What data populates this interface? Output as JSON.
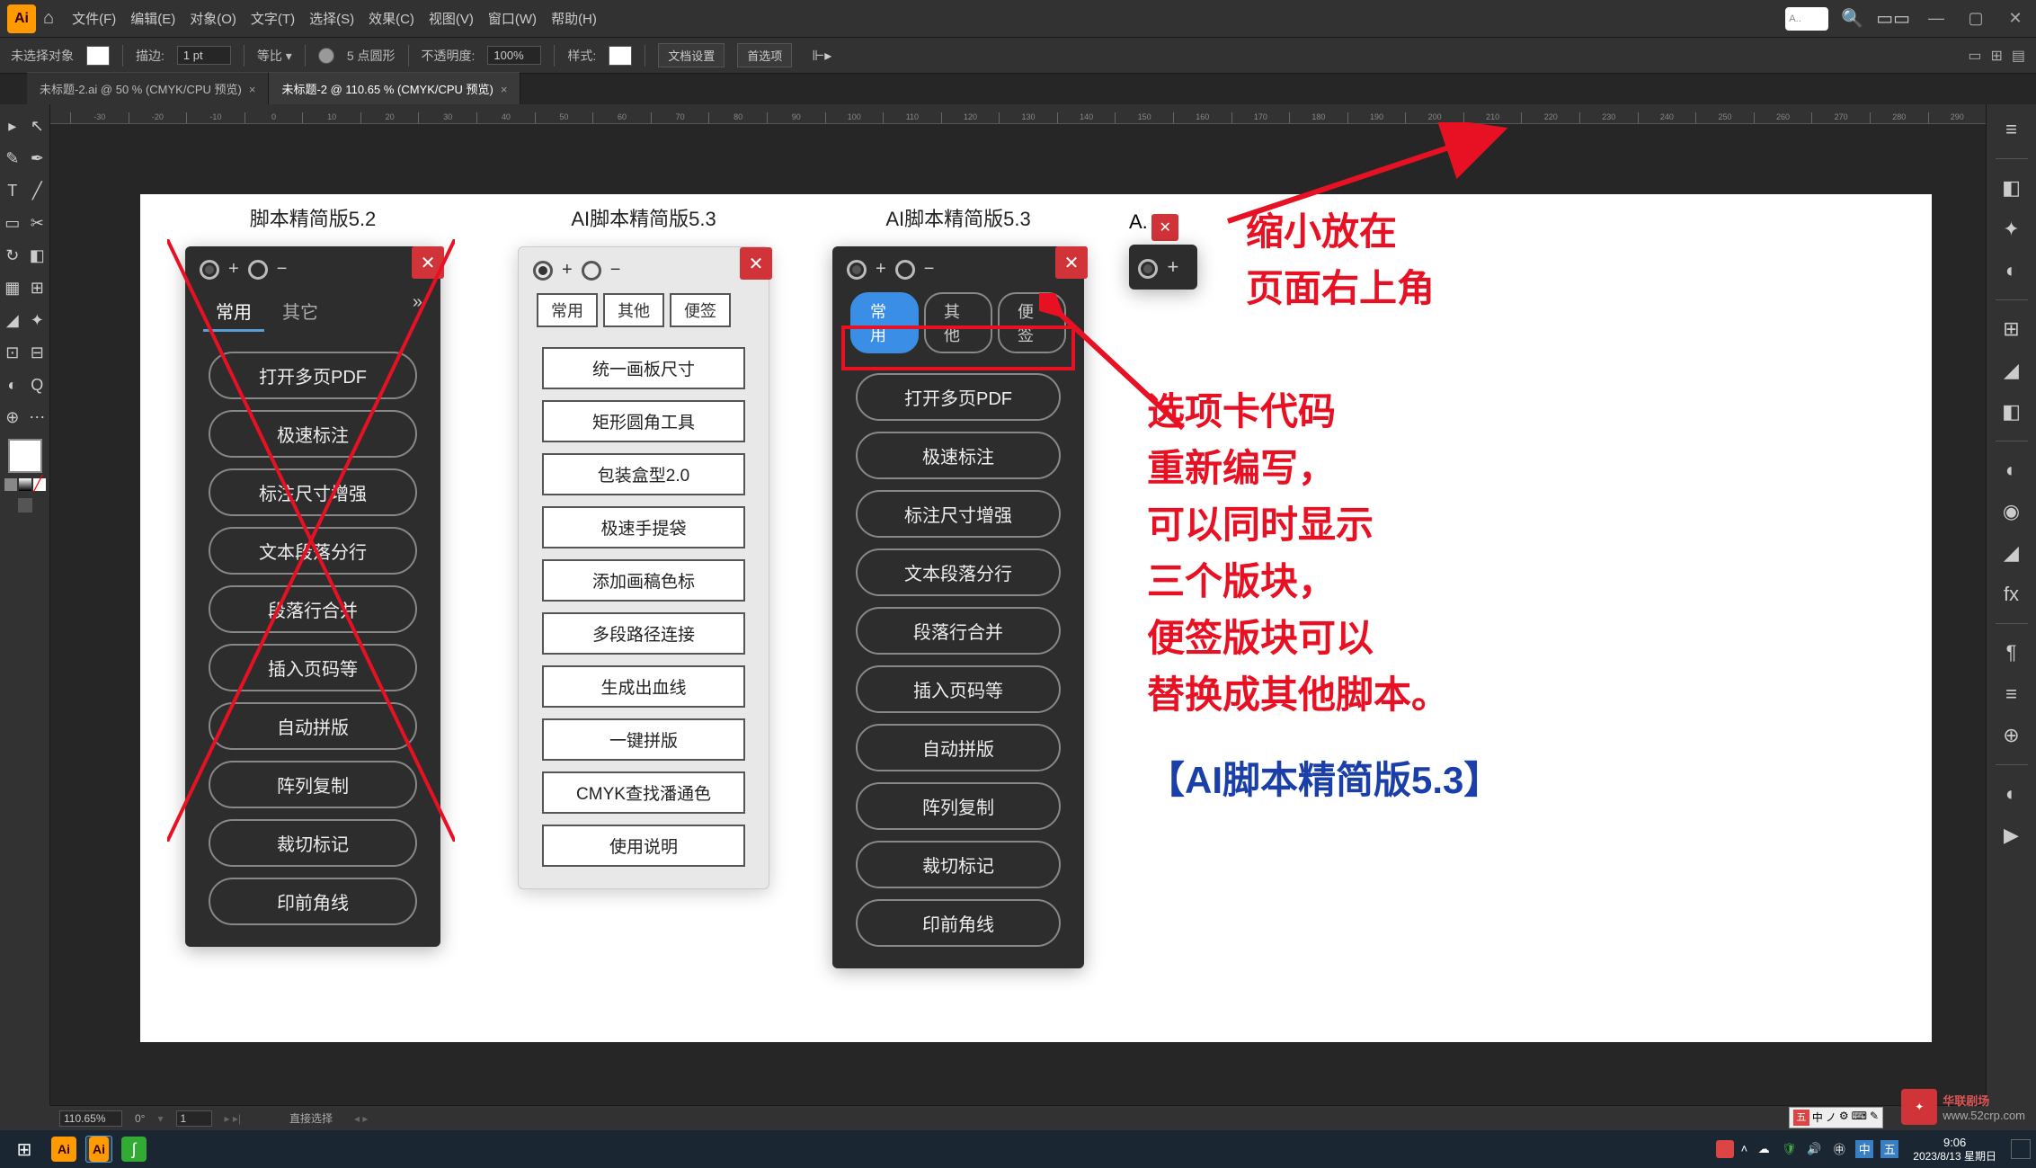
{
  "app": {
    "logo": "Ai",
    "home": "⌂"
  },
  "menu": [
    "文件(F)",
    "编辑(E)",
    "对象(O)",
    "文字(T)",
    "选择(S)",
    "效果(C)",
    "视图(V)",
    "窗口(W)",
    "帮助(H)"
  ],
  "top_right": {
    "search_placeholder": "A..",
    "search_icon": "🔍",
    "layout_icon": "▭▭"
  },
  "optbar": {
    "no_selection": "未选择对象",
    "stroke_label": "描边:",
    "stroke_val": "1 pt",
    "uniform": "等比 ▾",
    "brush": "5 点圆形",
    "opacity_label": "不透明度:",
    "opacity_val": "100%",
    "style_label": "样式:",
    "doc_setup": "文档设置",
    "prefs": "首选项"
  },
  "tabs": [
    {
      "label": "未标题-2.ai @ 50 % (CMYK/CPU 预览)",
      "active": false
    },
    {
      "label": "未标题-2 @ 110.65 % (CMYK/CPU 预览)",
      "active": true
    }
  ],
  "ruler_vals": [
    "-30",
    "-20",
    "-10",
    "0",
    "10",
    "20",
    "30",
    "40",
    "50",
    "60",
    "70",
    "80",
    "90",
    "100",
    "110",
    "120",
    "130",
    "140",
    "150",
    "160",
    "170",
    "180",
    "190",
    "200",
    "210",
    "220",
    "230",
    "240",
    "250",
    "260",
    "270",
    "280",
    "290"
  ],
  "panel52": {
    "title": "脚本精简版5.2",
    "tabs": [
      "常用",
      "其它"
    ],
    "buttons": [
      "打开多页PDF",
      "极速标注",
      "标注尺寸增强",
      "文本段落分行",
      "段落行合并",
      "插入页码等",
      "自动拼版",
      "阵列复制",
      "裁切标记",
      "印前角线"
    ]
  },
  "panel53_light": {
    "title": "AI脚本精简版5.3",
    "tabs": [
      "常用",
      "其他",
      "便签"
    ],
    "buttons": [
      "统一画板尺寸",
      "矩形圆角工具",
      "包装盒型2.0",
      "极速手提袋",
      "添加画稿色标",
      "多段路径连接",
      "生成出血线",
      "一键拼版",
      "CMYK查找潘通色",
      "使用说明"
    ]
  },
  "panel53_dark": {
    "title": "AI脚本精简版5.3",
    "tabs": [
      "常用",
      "其他",
      "便签"
    ],
    "buttons": [
      "打开多页PDF",
      "极速标注",
      "标注尺寸增强",
      "文本段落分行",
      "段落行合并",
      "插入页码等",
      "自动拼版",
      "阵列复制",
      "裁切标记",
      "印前角线"
    ]
  },
  "mini_panel": {
    "label": "A."
  },
  "annotation1": [
    "缩小放在",
    "页面右上角"
  ],
  "annotation2": [
    "选项卡代码",
    "重新编写，",
    "可以同时显示",
    "三个版块，",
    "便签版块可以",
    "替换成其他脚本。"
  ],
  "annotation3": "【AI脚本精简版5.3】",
  "anno3_color": "#1a3fa8",
  "statusbar": {
    "zoom": "110.65%",
    "rotate": "0°",
    "artboard": "1",
    "tool": "直接选择"
  },
  "tray_icons": [
    "☁",
    "🛡",
    "🔊",
    "㊥",
    "中",
    "五"
  ],
  "taskbar": {
    "time": "9:06",
    "date": "2023/8/13 星期日"
  },
  "watermark": {
    "txt1": "华联剧场",
    "txt2": "www.52crp.com"
  },
  "ime_bar": [
    "五",
    "中",
    "ノ",
    "⚙",
    "⌨",
    "✎"
  ],
  "left_tools": [
    "▸",
    "↖",
    "✎",
    "✒",
    "T",
    "╱",
    "▭",
    "✂",
    "↻",
    "◧",
    "▦",
    "⊞",
    "◢",
    "✦",
    "⊡",
    "⊟",
    "◐",
    "Q",
    "⊕",
    "⋯"
  ],
  "right_tools": [
    "≡",
    "◧",
    "✦",
    "◐",
    "⊞",
    "◢",
    "◧",
    "◐",
    "◉",
    "◢",
    "fx",
    "¶",
    "≡",
    "⊕",
    "◐",
    "▶"
  ]
}
